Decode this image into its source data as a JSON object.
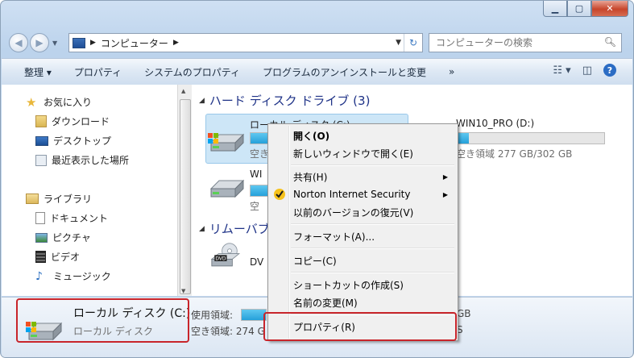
{
  "window": {
    "minimize": "▁",
    "maximize": "▢",
    "close": "✕"
  },
  "address": {
    "crumb": "コンピューター"
  },
  "search": {
    "placeholder": "コンピューターの検索"
  },
  "toolbar": {
    "organize": "整理 ▾",
    "properties": "プロパティ",
    "system_properties": "システムのプロパティ",
    "uninstall": "プログラムのアンインストールと変更",
    "more": "»",
    "help": "?"
  },
  "sidebar": {
    "favorites": "お気に入り",
    "downloads": "ダウンロード",
    "desktop": "デスクトップ",
    "recent": "最近表示した場所",
    "libraries": "ライブラリ",
    "documents": "ドキュメント",
    "pictures": "ピクチャ",
    "videos": "ビデオ",
    "music": "ミュージック"
  },
  "groups": {
    "hdd": "ハード ディスク ドライブ (3)",
    "removable": "リムーバブ"
  },
  "drives": {
    "c_name": "ローカル ディスク (C:)",
    "c_free": "空き",
    "win_name": "WI",
    "win_free": "空",
    "d_name": "WIN10_PRO (D:)",
    "d_free": "空き領域 277 GB/302 GB",
    "d_used_fraction": 0.08,
    "dvd_name": "DV"
  },
  "status": {
    "name": "ローカル ディスク (C:)",
    "type": "ローカル ディスク",
    "used_label": "使用領域:",
    "free_label": "空き領域: 274 G",
    "total_tail": "GB",
    "free_tail": "S"
  },
  "context_menu": {
    "open": "開く(O)",
    "open_new": "新しいウィンドウで開く(E)",
    "share": "共有(H)",
    "norton": "Norton Internet Security",
    "restore": "以前のバージョンの復元(V)",
    "format": "フォーマット(A)...",
    "copy": "コピー(C)",
    "shortcut": "ショートカットの作成(S)",
    "rename": "名前の変更(M)",
    "properties": "プロパティ(R)"
  }
}
